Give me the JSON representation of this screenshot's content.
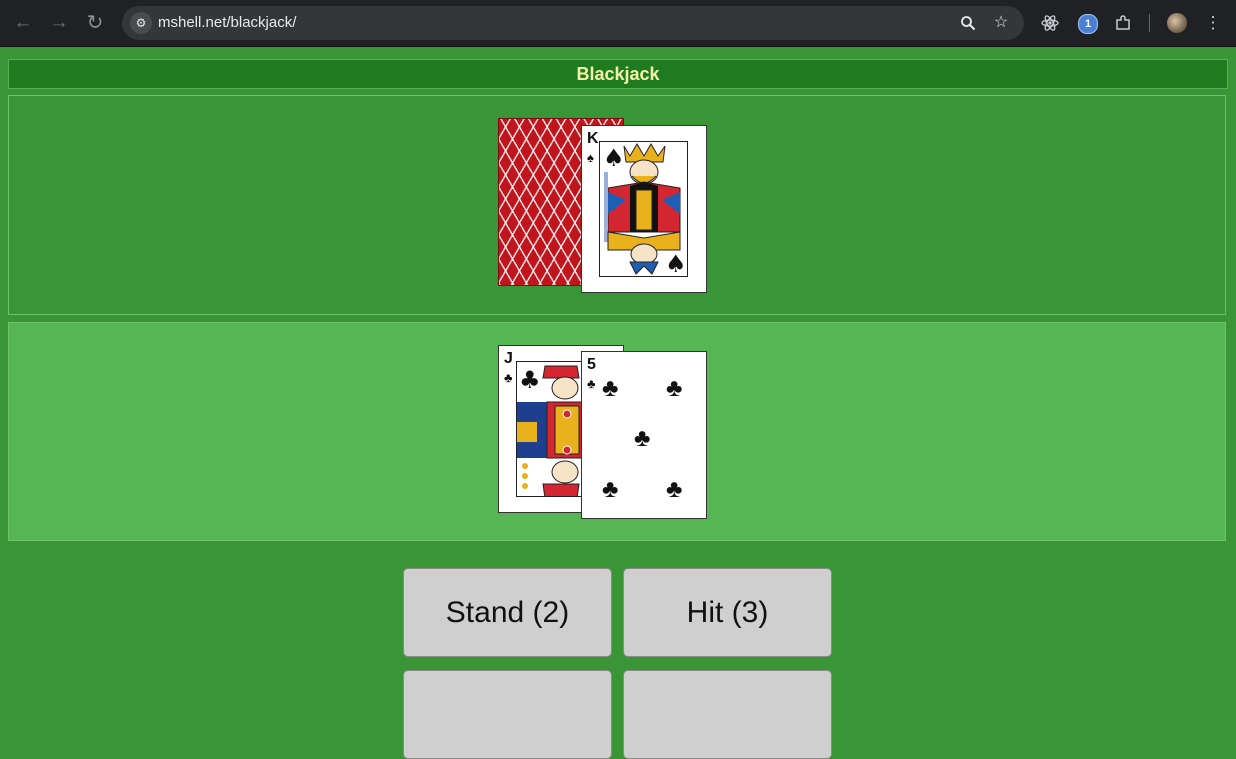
{
  "browser": {
    "url": "mshell.net/blackjack/",
    "icons": [
      "back-icon",
      "forward-icon",
      "reload-icon",
      "site-info-icon",
      "zoom-icon",
      "bookmark-star-icon",
      "react-devtools-icon",
      "onepassword-icon",
      "extensions-icon",
      "profile-avatar",
      "menu-icon"
    ]
  },
  "game": {
    "title": "Blackjack",
    "dealer_hand": [
      {
        "face_down": true
      },
      {
        "rank": "K",
        "suit": "♠",
        "suit_name": "spades"
      }
    ],
    "player_hand": [
      {
        "rank": "J",
        "suit": "♣",
        "suit_name": "clubs"
      },
      {
        "rank": "5",
        "suit": "♣",
        "suit_name": "clubs"
      }
    ],
    "buttons": {
      "stand": "Stand (2)",
      "hit": "Hit (3)",
      "extra_left": "",
      "extra_right": ""
    }
  },
  "colors": {
    "felt": "#3a9537",
    "title_bar": "#1f7b20",
    "title_text": "#f3f3a8",
    "player_area": "#55b653",
    "card_back": "#c0151c",
    "button": "#cfcfcf"
  }
}
